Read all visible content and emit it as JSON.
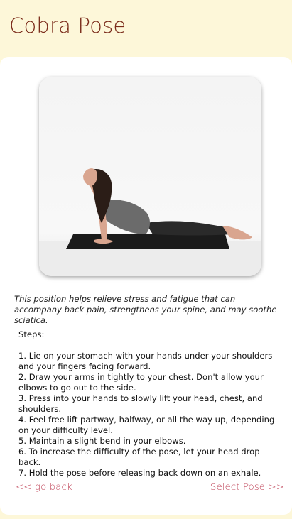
{
  "header": {
    "title": "Cobra Pose"
  },
  "pose_image": {
    "alt": "Woman performing cobra pose on a black yoga mat"
  },
  "description": "This position helps relieve stress and fatigue that can accompany back pain, strengthens your spine, and may soothe sciatica.",
  "steps": {
    "heading": "Steps:",
    "lines": [
      "1. Lie on your stomach with your hands under your shoulders and your fingers facing forward.",
      "2. Draw your arms in tightly to your chest. Don't allow your elbows to go out to the side.",
      "3. Press into your hands to slowly lift your head, chest, and shoulders.",
      "4. Feel free lift partway, halfway, or all the way up, depending on your difficulty level.",
      "5. Maintain a slight bend in your elbows.",
      "6. To increase the difficulty of the pose, let your head drop back.",
      "7. Hold the pose before releasing back down on an exhale."
    ]
  },
  "nav": {
    "back_label": "<< go back",
    "select_label": "Select Pose >>"
  },
  "colors": {
    "header_bg": "#fdf7d9",
    "title": "#7a2a19",
    "link": "#c1485c"
  }
}
